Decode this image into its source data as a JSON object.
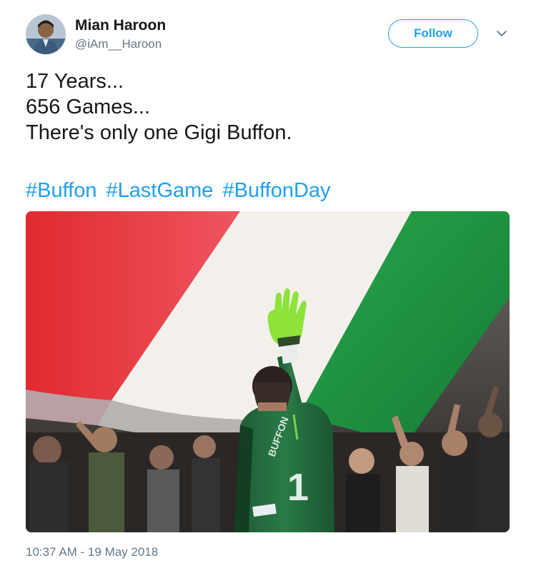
{
  "author": {
    "name": "Mian Haroon",
    "handle": "@iAm__Haroon"
  },
  "follow_button": {
    "label": "Follow"
  },
  "menu": {
    "icon": "chevron-down-icon"
  },
  "tweet": {
    "lines": [
      "17 Years...",
      "656 Games...",
      "There's only one Gigi Buffon."
    ],
    "hashtags": [
      "#Buffon",
      "#LastGame",
      "#BuffonDay"
    ],
    "timestamp": "10:37 AM - 19 May 2018"
  },
  "photo": {
    "jersey_name": "BUFFON",
    "jersey_number": "1"
  },
  "colors": {
    "accent": "#1da1f2",
    "text": "#14171a",
    "muted": "#657786",
    "flag_red": "#e8282f",
    "flag_white": "#f4f2ef",
    "flag_green": "#1f9a43",
    "jersey_green": "#1f6b3c",
    "glove": "#8de33a"
  }
}
